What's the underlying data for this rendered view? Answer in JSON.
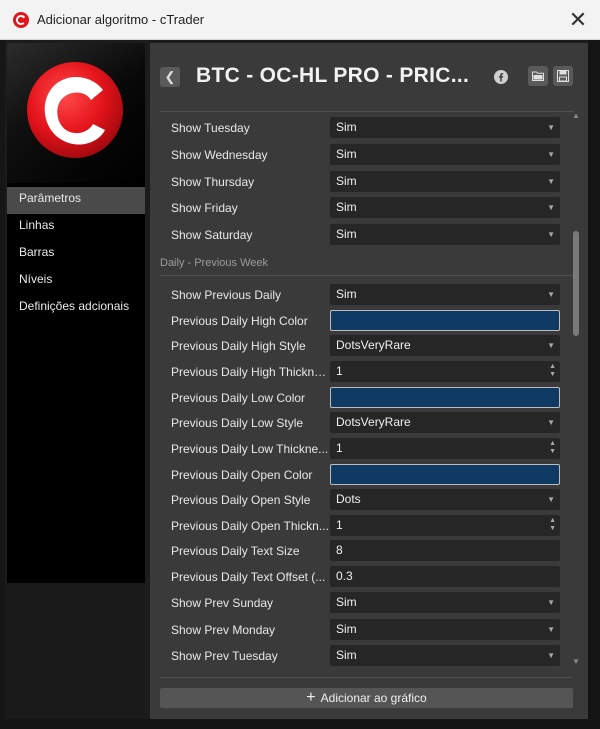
{
  "window": {
    "title": "Adicionar algoritmo - cTrader",
    "close_label": "✕"
  },
  "header": {
    "title": "BTC - OC-HL PRO - PRIC..."
  },
  "sidebar": {
    "items": [
      {
        "label": "Parâmetros",
        "active": true
      },
      {
        "label": "Linhas"
      },
      {
        "label": "Barras"
      },
      {
        "label": "Níveis"
      },
      {
        "label": "Definições adcionais"
      }
    ]
  },
  "params_top": [
    {
      "label": "Show Tuesday",
      "value": "Sim"
    },
    {
      "label": "Show Wednesday",
      "value": "Sim"
    },
    {
      "label": "Show Thursday",
      "value": "Sim"
    },
    {
      "label": "Show Friday",
      "value": "Sim"
    },
    {
      "label": "Show Saturday",
      "value": "Sim"
    }
  ],
  "section": {
    "title": "Daily - Previous Week"
  },
  "params": [
    {
      "label": "Show Previous Daily",
      "value": "Sim"
    },
    {
      "label": "Previous Daily High Color",
      "value": ""
    },
    {
      "label": "Previous Daily High Style",
      "value": "DotsVeryRare"
    },
    {
      "label": "Previous Daily High Thickness",
      "value": "1"
    },
    {
      "label": "Previous Daily Low Color",
      "value": ""
    },
    {
      "label": "Previous Daily Low Style",
      "value": "DotsVeryRare"
    },
    {
      "label": "Previous Daily Low Thickne...",
      "value": "1"
    },
    {
      "label": "Previous Daily Open Color",
      "value": ""
    },
    {
      "label": "Previous Daily Open Style",
      "value": "Dots"
    },
    {
      "label": "Previous Daily Open Thickn...",
      "value": "1"
    },
    {
      "label": "Previous Daily Text Size",
      "value": "8"
    },
    {
      "label": "Previous Daily Text Offset (...",
      "value": "0.3"
    },
    {
      "label": "Show Prev Sunday",
      "value": "Sim"
    },
    {
      "label": "Show Prev Monday",
      "value": "Sim"
    },
    {
      "label": "Show Prev Tuesday",
      "value": "Sim"
    }
  ],
  "footer": {
    "add_label": "Adicionar ao gráfico"
  },
  "colors": {
    "line_color": "#0e3a63",
    "accent_red": "#e4141b"
  }
}
